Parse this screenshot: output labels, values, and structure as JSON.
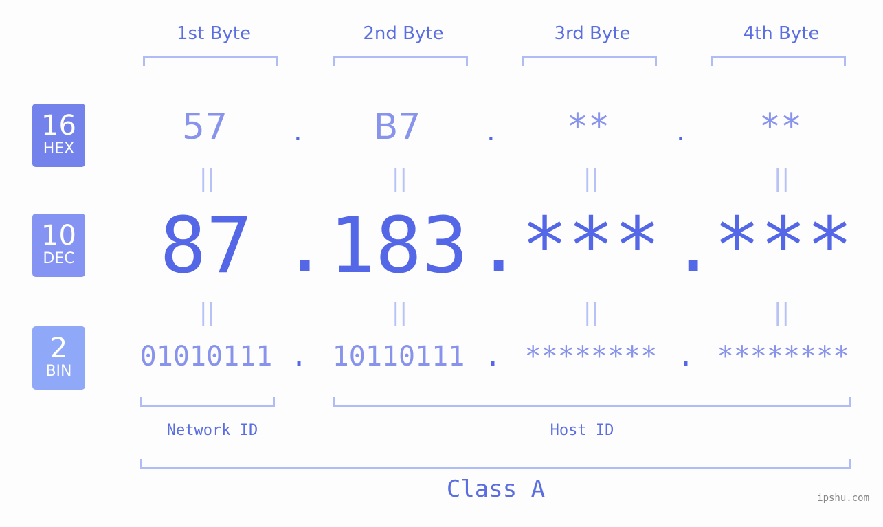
{
  "bytes": [
    {
      "label": "1st Byte",
      "hex": "57",
      "dec": "87",
      "bin": "01010111"
    },
    {
      "label": "2nd Byte",
      "hex": "B7",
      "dec": "183",
      "bin": "10110111"
    },
    {
      "label": "3rd Byte",
      "hex": "**",
      "dec": "***",
      "bin": "********"
    },
    {
      "label": "4th Byte",
      "hex": "**",
      "dec": "***",
      "bin": "********"
    }
  ],
  "bases": {
    "hex": {
      "num": "16",
      "label": "HEX",
      "color": "#7482ec"
    },
    "dec": {
      "num": "10",
      "label": "DEC",
      "color": "#8594f2"
    },
    "bin": {
      "num": "2",
      "label": "BIN",
      "color": "#90a8f8"
    }
  },
  "separator": ".",
  "equals": "||",
  "network_id_label": "Network ID",
  "host_id_label": "Host ID",
  "class_label": "Class A",
  "watermark": "ipshu.com"
}
